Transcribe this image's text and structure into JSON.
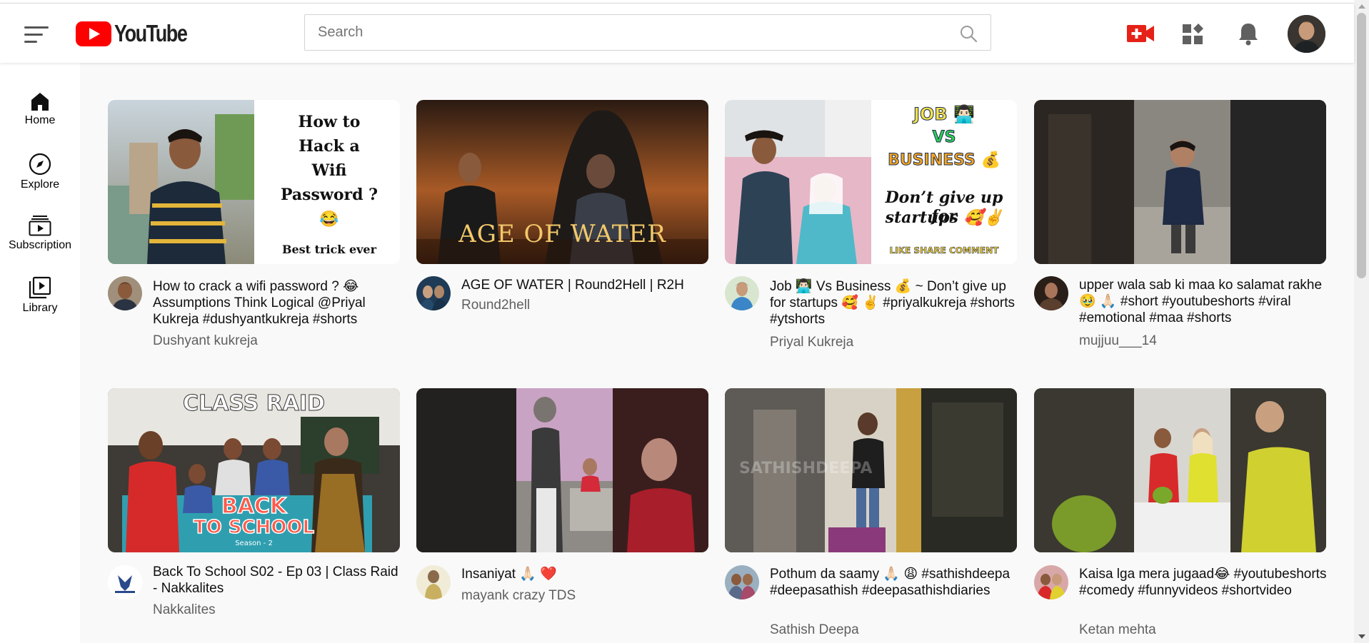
{
  "app": {
    "logo_text": "YouTube"
  },
  "search": {
    "placeholder": "Search",
    "value": ""
  },
  "header": {
    "icons": [
      "menu-icon",
      "create-video-icon",
      "apps-icon",
      "notifications-bell-icon",
      "user-avatar"
    ]
  },
  "sidebar": {
    "items": [
      {
        "label": "Home",
        "icon": "home-icon"
      },
      {
        "label": "Explore",
        "icon": "compass-icon"
      },
      {
        "label": "Subscription",
        "icon": "subscriptions-icon"
      },
      {
        "label": "Library",
        "icon": "library-icon"
      }
    ]
  },
  "videos": [
    {
      "title": "How to crack a wifi password ? 😂 Assumptions Think Logical @Priyal Kukreja #dushyantkukreja #shorts",
      "channel": "Dushyant kukreja",
      "thumb_text": {
        "line1": "How to",
        "line2": "Hack a",
        "line3": "Wifi",
        "line4": "Password ?",
        "line5": "😂",
        "line6": "Best trick ever"
      }
    },
    {
      "title": "AGE OF WATER | Round2Hell | R2H",
      "channel": "Round2hell",
      "thumb_text": {
        "title": "AGE OF WATER"
      }
    },
    {
      "title": "Job 👨🏻‍💻 Vs Business 💰 ~ Don’t give up for startups 🥰 ✌️ #priyalkukreja #shorts #ytshorts",
      "channel": "Priyal Kukreja",
      "thumb_text": {
        "line1": "JOB 👨🏻‍💻",
        "line2": "VS",
        "line3": "BUSINESS 💰",
        "line4": "Don’t give up for",
        "line5": "startups 🥰✌️",
        "line6": "LIKE SHARE COMMENT"
      }
    },
    {
      "title": "upper wala sab ki maa ko salamat rakhe🥹 🙏🏻 #short #youtubeshorts #viral #emotional #maa #shorts",
      "channel": "mujjuu___14"
    },
    {
      "title": "Back To School S02 - Ep 03 | Class Raid - Nakkalites",
      "channel": "Nakkalites",
      "thumb_text": {
        "top": "CLASS RAID",
        "bottom1": "BACK",
        "bottom2": "TO SCHOOL",
        "season": "Season - 2"
      }
    },
    {
      "title": "Insaniyat 🙏🏻 ❤️",
      "channel": "mayank crazy TDS"
    },
    {
      "title": "Pothum da saamy 🙏🏻 😩 #sathishdeepa #deepasathish #deepasathishdiaries",
      "channel": "Sathish Deepa",
      "thumb_text": {
        "watermark": "SATHISHDEEPA"
      }
    },
    {
      "title": "Kaisa lga mera jugaad😂 #youtubeshorts #comedy #funnyvideos #shortvideo",
      "channel": "Ketan mehta"
    }
  ],
  "colors": {
    "youtube_red": "#ff0000",
    "create_icon_red": "#e62117",
    "icon_gray": "#606060",
    "text_primary": "#0f0f0f",
    "text_secondary": "#606060"
  }
}
